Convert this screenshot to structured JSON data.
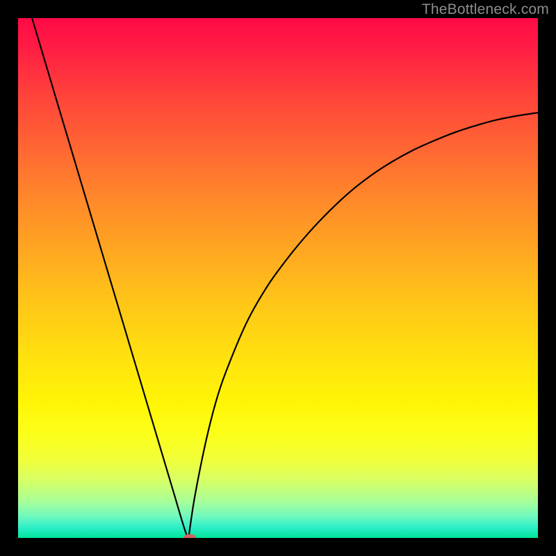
{
  "watermark": "TheBottleneck.com",
  "chart_data": {
    "type": "line",
    "title": "",
    "xlabel": "",
    "ylabel": "",
    "xlim": [
      0,
      100
    ],
    "ylim": [
      0,
      100
    ],
    "series": [
      {
        "name": "curve",
        "x": [
          0,
          4,
          8,
          12,
          16,
          20,
          24,
          28,
          30,
          32,
          32.8,
          33,
          34,
          36,
          38,
          40,
          44,
          48,
          52,
          56,
          60,
          64,
          68,
          72,
          76,
          80,
          84,
          88,
          92,
          96,
          100
        ],
        "values": [
          109,
          95.6,
          82.2,
          68.8,
          55.4,
          42.0,
          28.6,
          15.2,
          8.5,
          1.8,
          0,
          1.5,
          8.0,
          18.0,
          26.0,
          32.0,
          41.5,
          48.5,
          54.0,
          58.8,
          63.0,
          66.7,
          69.8,
          72.4,
          74.6,
          76.4,
          78.0,
          79.3,
          80.4,
          81.2,
          81.8
        ]
      }
    ],
    "marker": {
      "x": 33,
      "y": 0,
      "color": "#d96060"
    },
    "background_gradient": {
      "top": "#ff0a47",
      "bottom": "#00e59b"
    }
  }
}
